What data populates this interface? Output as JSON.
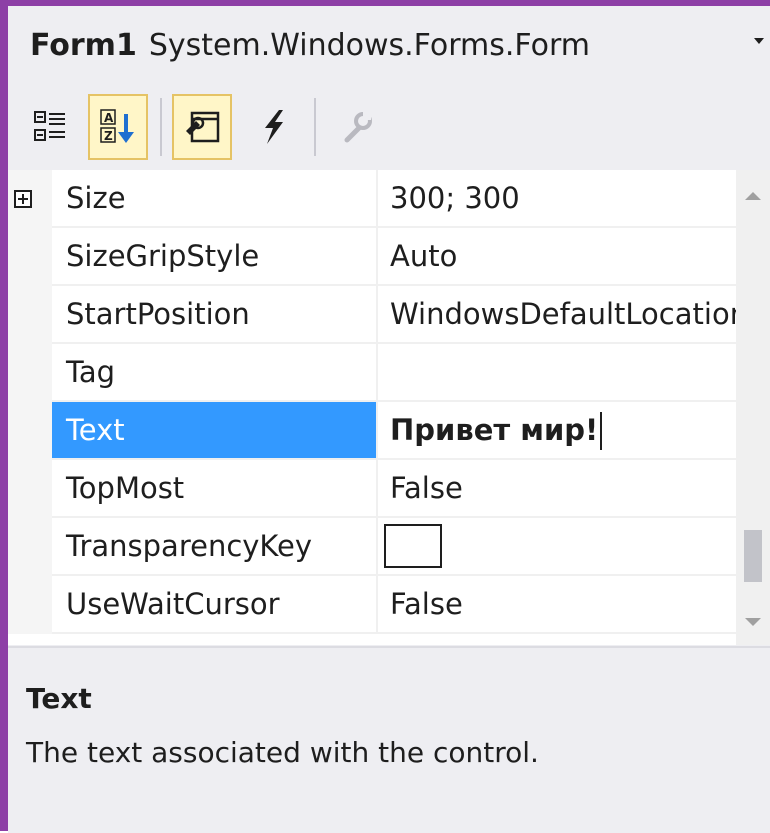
{
  "header": {
    "object_name": "Form1",
    "object_type": "System.Windows.Forms.Form"
  },
  "toolbar": {
    "buttons": [
      {
        "icon": "categorized-icon",
        "active": false
      },
      {
        "icon": "alphabetical-icon",
        "active": true
      },
      {
        "icon": "properties-icon",
        "active": true
      },
      {
        "icon": "events-icon",
        "active": false
      },
      {
        "icon": "property-pages-icon",
        "active": false,
        "disabled": true
      }
    ]
  },
  "grid": {
    "rows": [
      {
        "name": "Size",
        "value": "300; 300",
        "expandable": true
      },
      {
        "name": "SizeGripStyle",
        "value": "Auto"
      },
      {
        "name": "StartPosition",
        "value": "WindowsDefaultLocation"
      },
      {
        "name": "Tag",
        "value": ""
      },
      {
        "name": "Text",
        "value": "Привет мир!",
        "selected": true,
        "editing": true
      },
      {
        "name": "TopMost",
        "value": "False"
      },
      {
        "name": "TransparencyKey",
        "value": "",
        "color_swatch": "#ffffff"
      },
      {
        "name": "UseWaitCursor",
        "value": "False"
      }
    ]
  },
  "description": {
    "title": "Text",
    "text": "The text associated with the control."
  },
  "colors": {
    "accent": "#8d3fa6",
    "selection": "#3399ff",
    "toolbar_active_bg": "#fff6c8",
    "toolbar_active_border": "#e5c365"
  }
}
